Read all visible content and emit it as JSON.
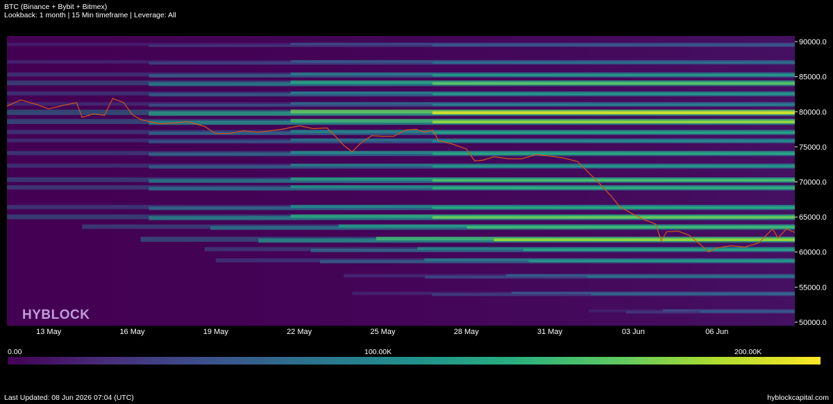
{
  "header": {
    "title": "BTC (Binance + Bybit + Bitmex)",
    "subtitle": "Lookback: 1 month | 15 Min timeframe | Leverage: All"
  },
  "watermark": "HYBLOCK",
  "colorbar": {
    "labels": [
      "0.00",
      "100.00K",
      "200.00K"
    ],
    "colors": [
      "#440154",
      "#3b528b",
      "#21918c",
      "#5ec962",
      "#fde725"
    ]
  },
  "footer": {
    "updated": "Last Updated: 08 Jun 2026 07:04 (UTC)",
    "site": "hyblockcapital.com"
  },
  "chart_data": {
    "type": "heatmap",
    "title": "BTC (Binance + Bybit + Bitmex)",
    "x_ticks": [
      "13 May",
      "16 May",
      "19 May",
      "22 May",
      "25 May",
      "28 May",
      "31 May",
      "03 Jun",
      "06 Jun"
    ],
    "y_ticks": [
      50000,
      55000,
      60000,
      65000,
      70000,
      75000,
      80000,
      85000,
      90000
    ],
    "y_tick_labels": [
      "50000.0",
      "55000.0",
      "60000.0",
      "65000.0",
      "70000.0",
      "75000.0",
      "80000.0",
      "85000.0",
      "90000.0"
    ],
    "x_range_days": [
      11.5,
      39.8
    ],
    "ylim": [
      49500,
      90800
    ],
    "liquidation_bands": [
      {
        "price": 89500,
        "strength": 0.3
      },
      {
        "price": 87000,
        "strength": 0.38
      },
      {
        "price": 85200,
        "strength": 0.55
      },
      {
        "price": 84000,
        "strength": 0.75
      },
      {
        "price": 82500,
        "strength": 0.55
      },
      {
        "price": 81000,
        "strength": 0.45
      },
      {
        "price": 79800,
        "strength": 0.95
      },
      {
        "price": 78500,
        "strength": 0.85
      },
      {
        "price": 77000,
        "strength": 0.6
      },
      {
        "price": 75800,
        "strength": 0.5
      },
      {
        "price": 74000,
        "strength": 0.62
      },
      {
        "price": 72200,
        "strength": 0.55
      },
      {
        "price": 70200,
        "strength": 0.72
      },
      {
        "price": 69100,
        "strength": 0.65
      },
      {
        "price": 66300,
        "strength": 0.62
      },
      {
        "price": 64900,
        "strength": 0.78
      },
      {
        "price": 63500,
        "strength": 0.7
      },
      {
        "price": 61700,
        "strength": 0.85
      },
      {
        "price": 60300,
        "strength": 0.6
      },
      {
        "price": 58700,
        "strength": 0.55
      },
      {
        "price": 56500,
        "strength": 0.4
      },
      {
        "price": 54000,
        "strength": 0.35
      },
      {
        "price": 51500,
        "strength": 0.3
      }
    ],
    "price_series": {
      "name": "BTC price",
      "color": "#d2581c",
      "points": [
        [
          11.5,
          80800
        ],
        [
          12.0,
          81700
        ],
        [
          12.6,
          81000
        ],
        [
          13.0,
          80400
        ],
        [
          13.5,
          80900
        ],
        [
          14.0,
          81300
        ],
        [
          14.2,
          79200
        ],
        [
          14.6,
          79700
        ],
        [
          15.0,
          79500
        ],
        [
          15.3,
          81900
        ],
        [
          15.7,
          81300
        ],
        [
          16.0,
          79600
        ],
        [
          16.3,
          78900
        ],
        [
          16.6,
          78600
        ],
        [
          17.0,
          78300
        ],
        [
          17.5,
          78400
        ],
        [
          18.0,
          78600
        ],
        [
          18.6,
          77900
        ],
        [
          19.0,
          76900
        ],
        [
          19.5,
          76900
        ],
        [
          20.0,
          77300
        ],
        [
          20.5,
          77100
        ],
        [
          21.0,
          77300
        ],
        [
          21.5,
          77600
        ],
        [
          22.0,
          78000
        ],
        [
          22.5,
          77600
        ],
        [
          23.0,
          77700
        ],
        [
          23.3,
          76500
        ],
        [
          23.6,
          75200
        ],
        [
          23.9,
          74300
        ],
        [
          24.2,
          75500
        ],
        [
          24.6,
          76600
        ],
        [
          25.0,
          76500
        ],
        [
          25.4,
          76500
        ],
        [
          25.8,
          77400
        ],
        [
          26.2,
          77500
        ],
        [
          26.5,
          77100
        ],
        [
          26.8,
          77400
        ],
        [
          27.0,
          75900
        ],
        [
          27.5,
          75400
        ],
        [
          28.0,
          74700
        ],
        [
          28.3,
          73000
        ],
        [
          28.6,
          73100
        ],
        [
          29.0,
          73600
        ],
        [
          29.5,
          73300
        ],
        [
          30.0,
          73300
        ],
        [
          30.5,
          73900
        ],
        [
          31.0,
          73700
        ],
        [
          31.5,
          73400
        ],
        [
          32.0,
          72900
        ],
        [
          32.4,
          71300
        ],
        [
          32.8,
          69700
        ],
        [
          33.2,
          68000
        ],
        [
          33.5,
          66500
        ],
        [
          33.9,
          65600
        ],
        [
          34.4,
          64600
        ],
        [
          34.8,
          64000
        ],
        [
          35.0,
          61600
        ],
        [
          35.2,
          62900
        ],
        [
          35.6,
          63000
        ],
        [
          36.0,
          62400
        ],
        [
          36.4,
          61100
        ],
        [
          36.7,
          60000
        ],
        [
          37.0,
          60600
        ],
        [
          37.5,
          60900
        ],
        [
          38.0,
          60700
        ],
        [
          38.5,
          61300
        ],
        [
          39.0,
          63300
        ],
        [
          39.2,
          62000
        ],
        [
          39.5,
          63300
        ],
        [
          39.8,
          62800
        ]
      ]
    }
  }
}
